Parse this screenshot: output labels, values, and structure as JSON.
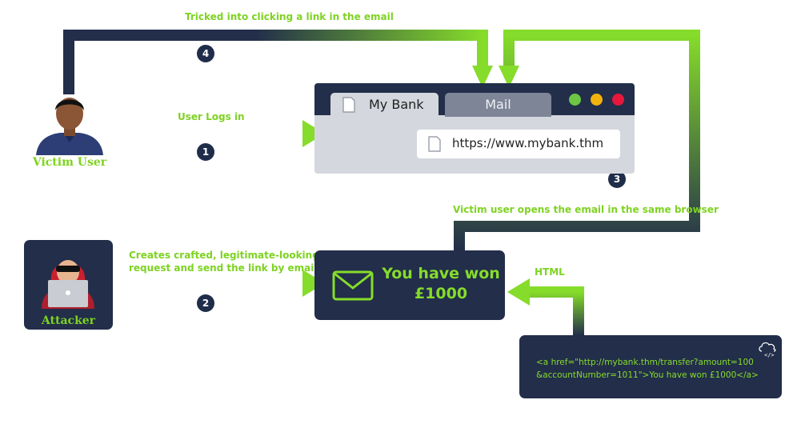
{
  "labels": {
    "step4_label": "Tricked into clicking a link in the email",
    "step1_label": "User Logs in",
    "step2_label_line1": "Creates crafted, legitimate-looking",
    "step2_label_line2": "request and send the link by email",
    "step3_label": "Victim user opens the email in the same browser",
    "html_label": "HTML"
  },
  "steps": [
    "1",
    "2",
    "3",
    "4"
  ],
  "actors": {
    "victim": "Victim User",
    "attacker": "Attacker"
  },
  "browser": {
    "tab_active": "My Bank",
    "tab_inactive": "Mail",
    "url": "https://www.mybank.thm",
    "window_dots": [
      "#6cc644",
      "#f1b20d",
      "#e8173c"
    ]
  },
  "email": {
    "line1": "You have won",
    "line2": "£1000"
  },
  "code": {
    "line1": "<a href=\"http://mybank.thm/transfer?amount=100",
    "line2": "&accountNumber=1011\">You have won £1000</a>"
  },
  "colors": {
    "navy": "#222e4a",
    "green": "#86dc2a",
    "label_green": "#7ed321"
  }
}
